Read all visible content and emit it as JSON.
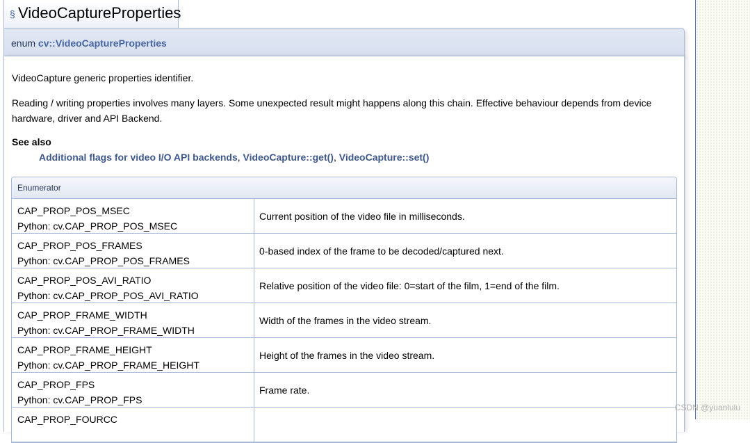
{
  "title": {
    "section_sign": "§",
    "text": "VideoCaptureProperties"
  },
  "proto": {
    "prefix": "enum ",
    "name": "cv::VideoCaptureProperties"
  },
  "doc": {
    "p1": "VideoCapture generic properties identifier.",
    "p2": "Reading / writing properties involves many layers. Some unexpected result might happens along this chain. Effective behaviour depends from device hardware, driver and API Backend.",
    "see_also_label": "See also",
    "see_also_links": [
      "Additional flags for video I/O API backends",
      "VideoCapture::get()",
      "VideoCapture::set()"
    ],
    "separator": ", "
  },
  "enum_table": {
    "header": "Enumerator",
    "rows": [
      {
        "name": "CAP_PROP_POS_MSEC",
        "python": "Python: cv.CAP_PROP_POS_MSEC",
        "desc": "Current position of the video file in milliseconds."
      },
      {
        "name": "CAP_PROP_POS_FRAMES",
        "python": "Python: cv.CAP_PROP_POS_FRAMES",
        "desc": "0-based index of the frame to be decoded/captured next."
      },
      {
        "name": "CAP_PROP_POS_AVI_RATIO",
        "python": "Python: cv.CAP_PROP_POS_AVI_RATIO",
        "desc": "Relative position of the video file: 0=start of the film, 1=end of the film."
      },
      {
        "name": "CAP_PROP_FRAME_WIDTH",
        "python": "Python: cv.CAP_PROP_FRAME_WIDTH",
        "desc": "Width of the frames in the video stream."
      },
      {
        "name": "CAP_PROP_FRAME_HEIGHT",
        "python": "Python: cv.CAP_PROP_FRAME_HEIGHT",
        "desc": "Height of the frames in the video stream."
      },
      {
        "name": "CAP_PROP_FPS",
        "python": "Python: cv.CAP_PROP_FPS",
        "desc": "Frame rate."
      },
      {
        "name": "CAP_PROP_FOURCC",
        "python": "",
        "desc": ""
      }
    ]
  },
  "watermark": "CSDN @yuanlulu"
}
